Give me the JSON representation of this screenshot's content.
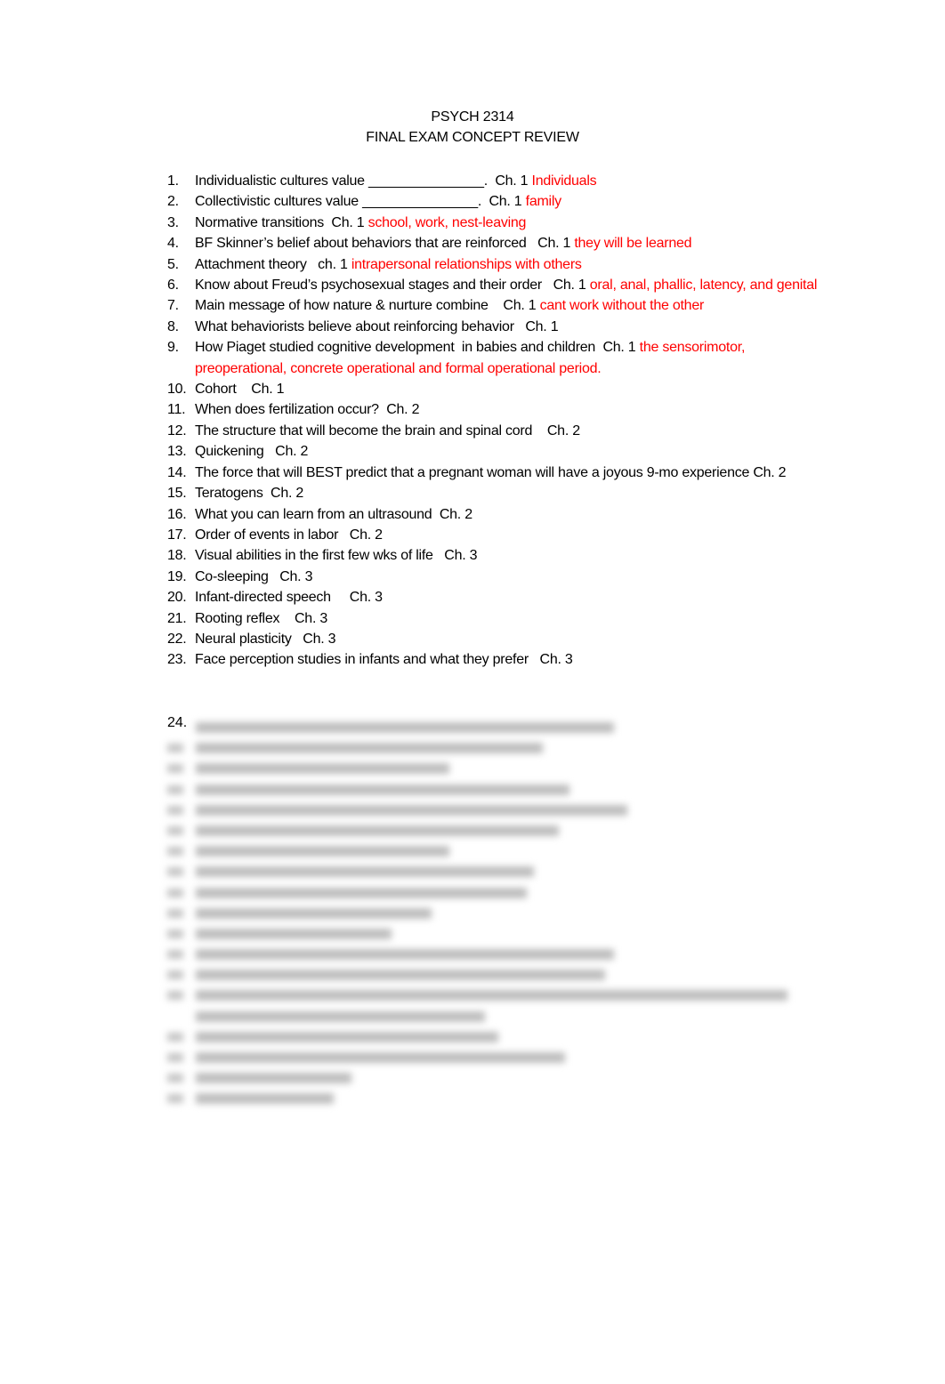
{
  "document": {
    "course": "PSYCH 2314",
    "title": "FINAL EXAM CONCEPT REVIEW"
  },
  "items": [
    {
      "n": "1.",
      "q": "Individualistic cultures value _______________.  Ch. 1 ",
      "a": "Individuals"
    },
    {
      "n": "2.",
      "q": "Collectivistic cultures value _______________.  Ch. 1 ",
      "a": "family"
    },
    {
      "n": "3.",
      "q": "Normative transitions  Ch. 1 ",
      "a": "school, work, nest-leaving"
    },
    {
      "n": "4.",
      "q": "BF Skinner’s belief about behaviors that are reinforced   Ch. 1 ",
      "a": "they will be learned"
    },
    {
      "n": "5.",
      "q": "Attachment theory   ch. 1 ",
      "a": "intrapersonal relationships with others"
    },
    {
      "n": "6.",
      "q": "Know about Freud’s psychosexual stages and their order   Ch. 1 ",
      "a": "oral, anal, phallic, latency, and genital"
    },
    {
      "n": "7.",
      "q": "Main message of how nature & nurture combine    Ch. 1 ",
      "a": "cant work without the other"
    },
    {
      "n": "8.",
      "q": "What behaviorists believe about reinforcing behavior   Ch. 1",
      "a": ""
    },
    {
      "n": "9.",
      "q": "How Piaget studied cognitive development  in babies and children  Ch. 1 ",
      "a": "the sensorimotor, preoperational, concrete operational and formal operational period."
    },
    {
      "n": "10.",
      "q": "Cohort    Ch. 1",
      "a": ""
    },
    {
      "n": "11.",
      "q": "When does fertilization occur?  Ch. 2",
      "a": ""
    },
    {
      "n": "12.",
      "q": "The structure that will become the brain and spinal cord    Ch. 2",
      "a": ""
    },
    {
      "n": "13.",
      "q": "Quickening   Ch. 2",
      "a": ""
    },
    {
      "n": "14.",
      "q": "The force that will BEST predict that a pregnant woman will have a joyous 9-mo experience Ch. 2",
      "a": ""
    },
    {
      "n": "15.",
      "q": "Teratogens  Ch. 2",
      "a": ""
    },
    {
      "n": "16.",
      "q": "What you can learn from an ultrasound  Ch. 2",
      "a": ""
    },
    {
      "n": "17.",
      "q": "Order of events in labor   Ch. 2",
      "a": ""
    },
    {
      "n": "18.",
      "q": "Visual abilities in the first few wks of life   Ch. 3",
      "a": ""
    },
    {
      "n": "19.",
      "q": "Co-sleeping   Ch. 3",
      "a": ""
    },
    {
      "n": "20.",
      "q": "Infant-directed speech     Ch. 3",
      "a": ""
    },
    {
      "n": "21.",
      "q": "Rooting reflex    Ch. 3",
      "a": ""
    },
    {
      "n": "22.",
      "q": "Neural plasticity   Ch. 3",
      "a": ""
    },
    {
      "n": "23.",
      "q": "Face perception studies in infants and what they prefer   Ch. 3",
      "a": ""
    }
  ],
  "blurred": {
    "first_visible_number": "24.",
    "note": "Items 24 onward are blurred and unreadable"
  }
}
